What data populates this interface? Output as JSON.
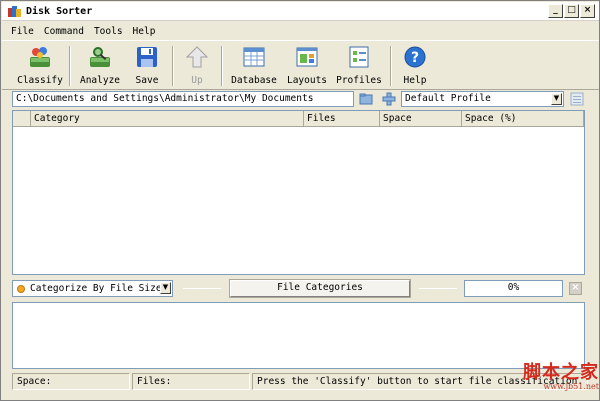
{
  "window": {
    "title": "Disk Sorter"
  },
  "menu": [
    "File",
    "Command",
    "Tools",
    "Help"
  ],
  "toolbar": [
    {
      "label": "Classify",
      "icon": "classify-icon",
      "enabled": true
    },
    {
      "label": "Analyze",
      "icon": "analyze-icon",
      "enabled": true
    },
    {
      "label": "Save",
      "icon": "save-icon",
      "enabled": true
    },
    {
      "label": "Up",
      "icon": "up-arrow-icon",
      "enabled": false
    },
    {
      "label": "Database",
      "icon": "database-icon",
      "enabled": true
    },
    {
      "label": "Layouts",
      "icon": "layouts-icon",
      "enabled": true
    },
    {
      "label": "Profiles",
      "icon": "profiles-icon",
      "enabled": true
    },
    {
      "label": "Help",
      "icon": "help-icon",
      "enabled": true
    }
  ],
  "path": {
    "value": "C:\\Documents and Settings\\Administrator\\My Documents"
  },
  "profile": {
    "selected": "Default Profile"
  },
  "table": {
    "columns": [
      "Category",
      "Files",
      "Space",
      "Space (%)"
    ]
  },
  "categorize": {
    "selected": "Categorize By File Size",
    "button_label": "File Categories",
    "progress": "0%"
  },
  "status": {
    "space": "Space:",
    "files": "Files:",
    "message": "Press the 'Classify' button to start file classification."
  },
  "watermark": {
    "main": "脚本之家",
    "sub": "www.jb51.net"
  },
  "colors": {
    "titlebar_bg": "#ffffff",
    "frame": "#ece9d8",
    "field_border": "#7f9db9",
    "watermark": "#d42a1e"
  }
}
